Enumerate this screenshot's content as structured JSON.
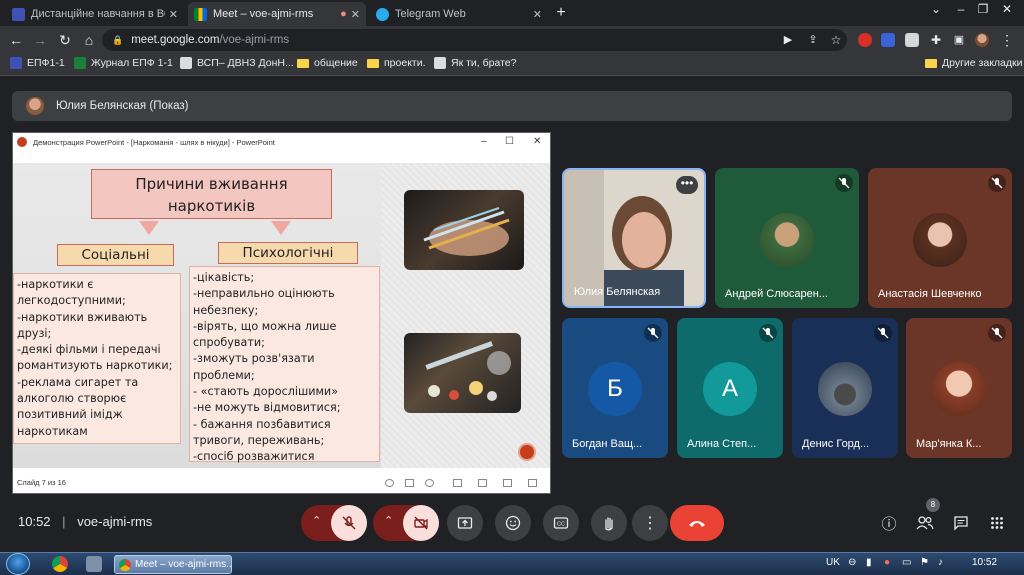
{
  "browser": {
    "tabs": [
      {
        "label": "Дистанційне навчання в ВСП",
        "active": false,
        "favicon": "classroom-icon"
      },
      {
        "label": "Meet – voe-ajmi-rms",
        "active": true,
        "favicon": "meet-icon"
      },
      {
        "label": "Telegram Web",
        "active": false,
        "favicon": "telegram-icon"
      }
    ],
    "url_host": "meet.google.com",
    "url_path": "/voe-ajmi-rms",
    "bookmarks": [
      "ЕПФ1-1",
      "Журнал ЕПФ 1-1",
      "ВСП– ДВНЗ ДонН...",
      "общение",
      "проекти.",
      "Як ти, брате?"
    ],
    "other_bookmarks": "Другие закладки"
  },
  "meet": {
    "presenter_label": "Юлия Белянская (Показ)",
    "meeting_code": "voe-ajmi-rms",
    "time": "10:52",
    "participants_count": "8",
    "participants": [
      {
        "name": "Юлия Белянская",
        "initial": "",
        "muted": false,
        "bg": "#6b5e56"
      },
      {
        "name": "Андрей Слюсарен...",
        "initial": "",
        "muted": true,
        "bg": "#1f5a3a"
      },
      {
        "name": "Анастасія Шевченко",
        "initial": "",
        "muted": true,
        "bg": "#6b3528"
      },
      {
        "name": "Богдан Ващ...",
        "initial": "Б",
        "muted": true,
        "bg": "#1a4b80",
        "circle": "#1558a6"
      },
      {
        "name": "Алина Степ...",
        "initial": "А",
        "muted": true,
        "bg": "#0d6b6b",
        "circle": "#12999a"
      },
      {
        "name": "Денис Горд...",
        "initial": "",
        "muted": true,
        "bg": "#1a2f57"
      },
      {
        "name": "Мар'янка К...",
        "initial": "",
        "muted": true,
        "bg": "#6b3528"
      }
    ]
  },
  "powerpoint": {
    "window_title": "Демонстрация PowerPoint - [Наркоманія - шлях в нікуди] - PowerPoint",
    "slide_status": "Слайд 7 из 16",
    "slide": {
      "title": "Причини вживання наркотиків",
      "social_header": "Соціальні",
      "psych_header": "Психологічні",
      "social_text": "-наркотики є легкодоступними;\n-наркотики вживають друзі;\n-деякі фільми і передачі романтизують наркотики;\n-реклама сигарет та алкоголю  створює позитивний імідж наркотикам",
      "psych_text": "-цікавість;\n-неправильно оцінюють небезпеку;\n-вірять, що можна лише спробувати;\n-зможуть розв'язати проблеми;\n- «стають дорослішими»\n-не можуть відмовитися;\n- бажання позбавитися тривоги, переживань;\n-спосіб розважитися"
    }
  },
  "taskbar": {
    "task_label": "Meet – voe-ajmi-rms...",
    "lang": "UK",
    "clock": "10:52"
  },
  "colors": {
    "meet_bg": "#202124",
    "end_call": "#ea4335",
    "muted_ctrl": "#f9dedc",
    "self_border": "#8ab4f8"
  }
}
